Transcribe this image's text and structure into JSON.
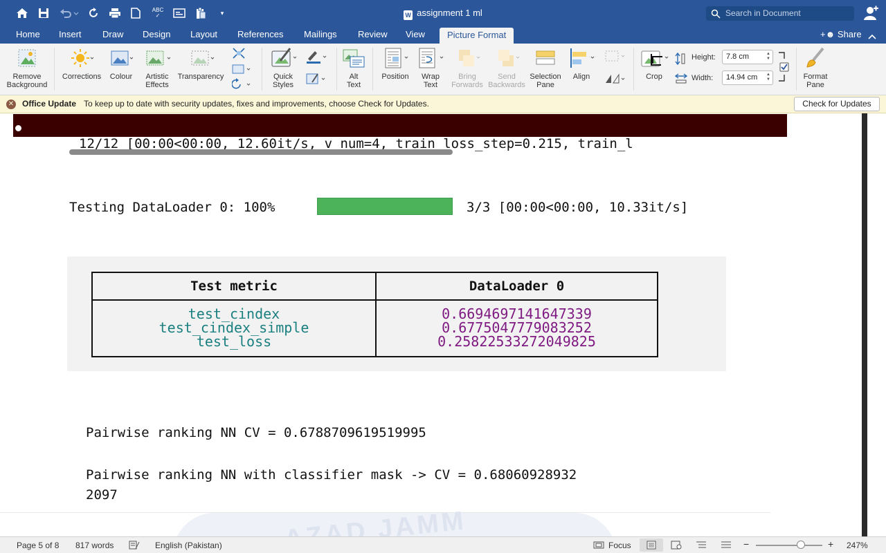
{
  "title_bar": {
    "document_title": "assignment 1 ml",
    "search_placeholder": "Search in Document",
    "quick_access_icons": [
      "home-icon",
      "save-icon",
      "undo-icon",
      "redo-icon",
      "print-icon",
      "new-document-icon",
      "spelling-icon",
      "view-icon",
      "paste-icon",
      "customize-icon"
    ]
  },
  "tabs": [
    "Home",
    "Insert",
    "Draw",
    "Design",
    "Layout",
    "References",
    "Mailings",
    "Review",
    "View",
    "Picture Format"
  ],
  "active_tab": "Picture Format",
  "share_label": "Share",
  "ribbon": {
    "remove_background": [
      "Remove",
      "Background"
    ],
    "corrections": "Corrections",
    "colour": "Colour",
    "artistic_effects": [
      "Artistic",
      "Effects"
    ],
    "transparency": "Transparency",
    "quick_styles": [
      "Quick",
      "Styles"
    ],
    "alt_text": [
      "Alt",
      "Text"
    ],
    "position": "Position",
    "wrap_text": [
      "Wrap",
      "Text"
    ],
    "bring_forwards": [
      "Bring",
      "Forwards"
    ],
    "send_backwards": [
      "Send",
      "Backwards"
    ],
    "selection_pane": [
      "Selection",
      "Pane"
    ],
    "align": "Align",
    "crop": "Crop",
    "height_label": "Height:",
    "height_value": "7.8 cm",
    "width_label": "Width:",
    "width_value": "14.94 cm",
    "format_pane": [
      "Format",
      "Pane"
    ]
  },
  "message_bar": {
    "title": "Office Update",
    "text": "To keep up to date with security updates, fixes and improvements, choose Check for Updates.",
    "button": "Check for Updates"
  },
  "document": {
    "progress_line": "12/12 [00:00<00:00, 12.60it/s, v_num=4, train_loss_step=0.215, train_l",
    "testing_label": "Testing DataLoader 0: 100%",
    "testing_progress": 1.0,
    "testing_stats": "3/3 [00:00<00:00, 10.33it/s]",
    "table": {
      "headers": [
        "Test metric",
        "DataLoader 0"
      ],
      "metrics": [
        "test_cindex",
        "test_cindex_simple",
        "test_loss"
      ],
      "values": [
        "0.6694697141647339",
        "0.6775047779083252",
        "0.25822533272049825"
      ]
    },
    "result_line1": "Pairwise ranking NN CV = 0.6788709619519995",
    "result_line2a": "Pairwise ranking NN with classifier mask -> CV = 0.68060928932",
    "result_line2b": "2097",
    "watermark": "AZAD JAMM"
  },
  "status_bar": {
    "page": "Page 5 of 8",
    "words": "817 words",
    "language": "English (Pakistan)",
    "focus": "Focus",
    "zoom": "247%"
  },
  "colors": {
    "brand": "#2b579a",
    "progress_green": "#4cb35b",
    "metric_teal": "#1a7f7f",
    "value_purple": "#7f1a82",
    "dark_band": "#3a0000"
  }
}
